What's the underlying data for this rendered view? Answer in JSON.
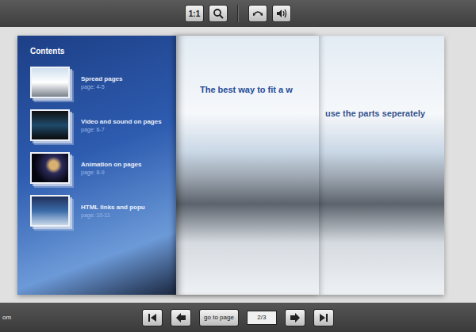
{
  "toolbar": {
    "actual_size": "1:1"
  },
  "contents": {
    "title": "Contents",
    "items": [
      {
        "title": "Spread pages",
        "page": "page: 4-5"
      },
      {
        "title": "Video and sound on pages",
        "page": "page: 6-7"
      },
      {
        "title": "Animation on pages",
        "page": "page: 8-9"
      },
      {
        "title": "HTML links and popu",
        "page": "page: 10-11"
      }
    ]
  },
  "spread": {
    "captions": [
      "The best way to fit a w",
      "use the parts seperately"
    ]
  },
  "footer": {
    "site": "om",
    "go_to_page": "go to page",
    "page_field": "2/3"
  }
}
